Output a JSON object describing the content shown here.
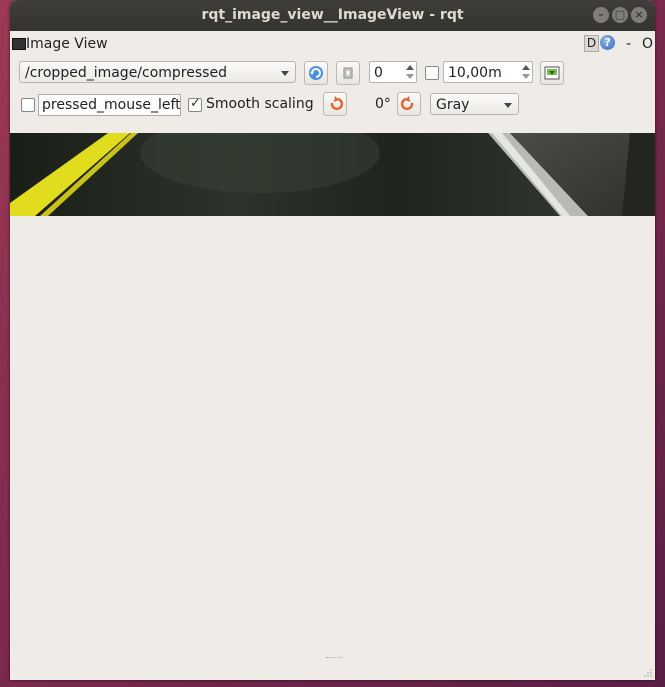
{
  "window": {
    "title": "rqt_image_view__ImageView - rqt",
    "minimize_glyph": "–",
    "maximize_glyph": "□",
    "close_glyph": "×"
  },
  "plugin": {
    "title": "Image View",
    "d_label": "D",
    "help_label": "?",
    "dash_label": "-",
    "o_label": "O"
  },
  "toolbar": {
    "topic": "/cropped_image/compressed",
    "refresh_icon": "refresh-icon",
    "zoom_value": "0",
    "rate_value": "10,00m",
    "save_icon": "save-image-icon",
    "mouse_topic": "pressed_mouse_left",
    "smooth_scaling_label": "Smooth scaling",
    "smooth_scaling_checked": true,
    "rotation_label": "0°",
    "colormap": "Gray"
  },
  "colors": {
    "title_bar": "#3c3b37",
    "window_bg": "#efebe7",
    "lane_yellow": "#e2dc1e"
  }
}
